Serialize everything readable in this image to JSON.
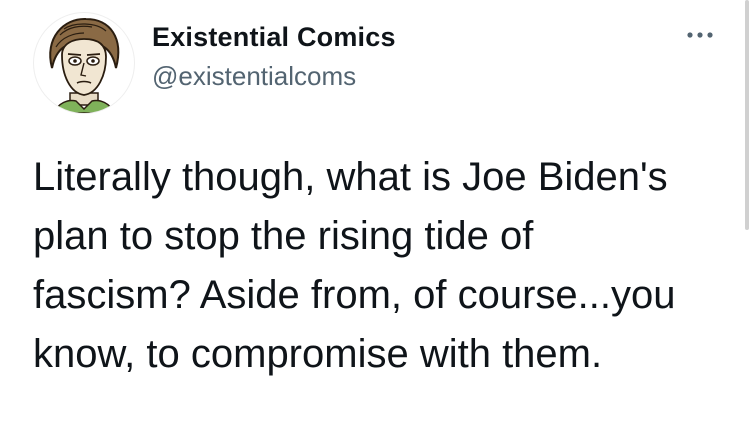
{
  "author": {
    "display_name": "Existential Comics",
    "handle": "@existentialcoms",
    "avatar_icon": "cartoon-portrait-avatar"
  },
  "menu": {
    "icon": "more-horizontal-icon"
  },
  "tweet": {
    "lines": [
      "Literally though, what is Joe Biden's",
      "plan to stop the rising tide of",
      "fascism? Aside from, of course...you",
      "know, to compromise with them."
    ]
  },
  "colors": {
    "text_primary": "#0f1419",
    "text_secondary": "#536471"
  }
}
